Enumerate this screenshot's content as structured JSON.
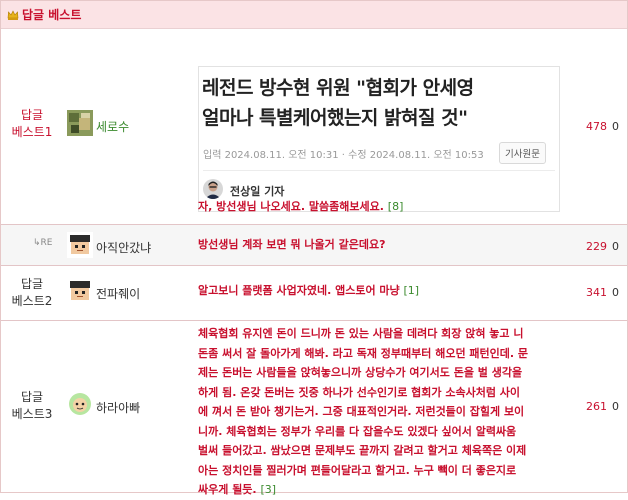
{
  "header": {
    "title": "답글 베스트",
    "icon": "crown-icon"
  },
  "rows": [
    {
      "rank": "답글\n베스트1",
      "nick": "세로수",
      "news": {
        "headline_line1": "레전드 방수현 위원 \"협회가 안세영",
        "headline_line2": "얼마나 특별케어했는지 밝혀질 것\"",
        "meta": "입력 2024.08.11. 오전 10:31 · 수정 2024.08.11. 오전 10:53",
        "source_button": "기사원문",
        "reporter": "전상일 기자"
      },
      "comment": "자, 방선생님 나오세요. 말씀좀해보세요.",
      "reply_count": "[8]",
      "likes": "478",
      "dislikes": "0"
    },
    {
      "rank": "RE",
      "nick": "아직안갔냐",
      "comment": "방선생님 계좌 보면 뭐 나올거 같은데요?",
      "likes": "229",
      "dislikes": "0"
    },
    {
      "rank": "답글\n베스트2",
      "nick": "전파줴이",
      "comment": "알고보니 플랫폼 사업자였네. 앱스토어 마냥",
      "reply_count": "[1]",
      "likes": "341",
      "dislikes": "0"
    },
    {
      "rank": "답글\n베스트3",
      "nick": "하라아빠",
      "comment_lines": [
        "체육협회 유지엔 돈이 드니까 돈 있는 사람을 데려다 회장 앉혀 놓고 니",
        "돈좀 써서 잘 돌아가게 해봐. 라고 독재 정부때부터 해오던 패턴인데. 문",
        "제는 돈버는 사람들을 앉혀놓으니까 상당수가 여기서도 돈을 벌 생각을",
        "하게 됨. 온갖 돈버는 짓중 하나가 선수인기로 협회가 소속사처럼 사이",
        "에 껴서 돈 받아 챙기는거. 그중 대표적인거라. 저런것들이 잡힐게 보이",
        "니까. 체육협회는 정부가 우리를 다 잡을수도 있겠다 싶어서 알력싸움",
        "벌써 들어갔고. 쌈났으면 문제부도 끝까지 갈려고 할거고 체육쪽은 이제",
        "아는 정치인들 찔러가며 편들어달라고 할거고. 누구 빽이 더 좋은지로",
        "싸우게 될듯."
      ],
      "reply_count": "[3]",
      "likes": "261",
      "dislikes": "0"
    }
  ],
  "colors": {
    "accent": "#c8102e",
    "header_bg": "#fbe3e5",
    "nick_green": "#3b8a2e"
  }
}
